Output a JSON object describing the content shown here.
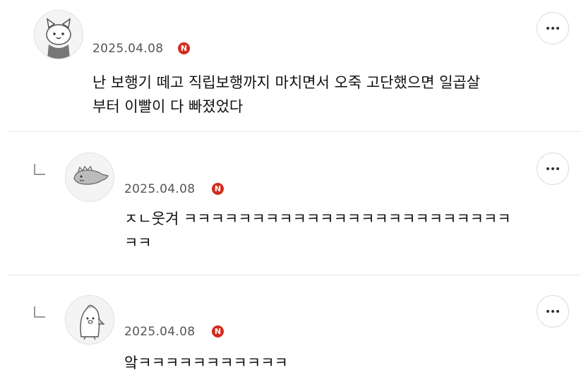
{
  "comments": [
    {
      "date": "2025.04.08",
      "badge": "N",
      "text": "난 보행기 떼고 직립보행까지 마치면서 오죽 고단했으면 일곱살\n부터 이빨이 다 빠졌었다",
      "avatar_icon": "cat-avatar-icon",
      "is_reply": false
    },
    {
      "date": "2025.04.08",
      "badge": "N",
      "text": "ㅈㄴ웃겨 ㅋㅋㅋㅋㅋㅋㅋㅋㅋㅋㅋㅋㅋㅋㅋㅋㅋㅋㅋㅋㅋㅋㅋㅋ\nㅋㅋ",
      "avatar_icon": "dinosaur-avatar-icon",
      "is_reply": true
    },
    {
      "date": "2025.04.08",
      "badge": "N",
      "text": "앜ㅋㅋㅋㅋㅋㅋㅋㅋㅋㅋㅋ",
      "avatar_icon": "penguin-avatar-icon",
      "is_reply": true
    }
  ],
  "colors": {
    "badge": "#d22b1f",
    "divider": "#e6e6e6",
    "date": "#555555"
  }
}
